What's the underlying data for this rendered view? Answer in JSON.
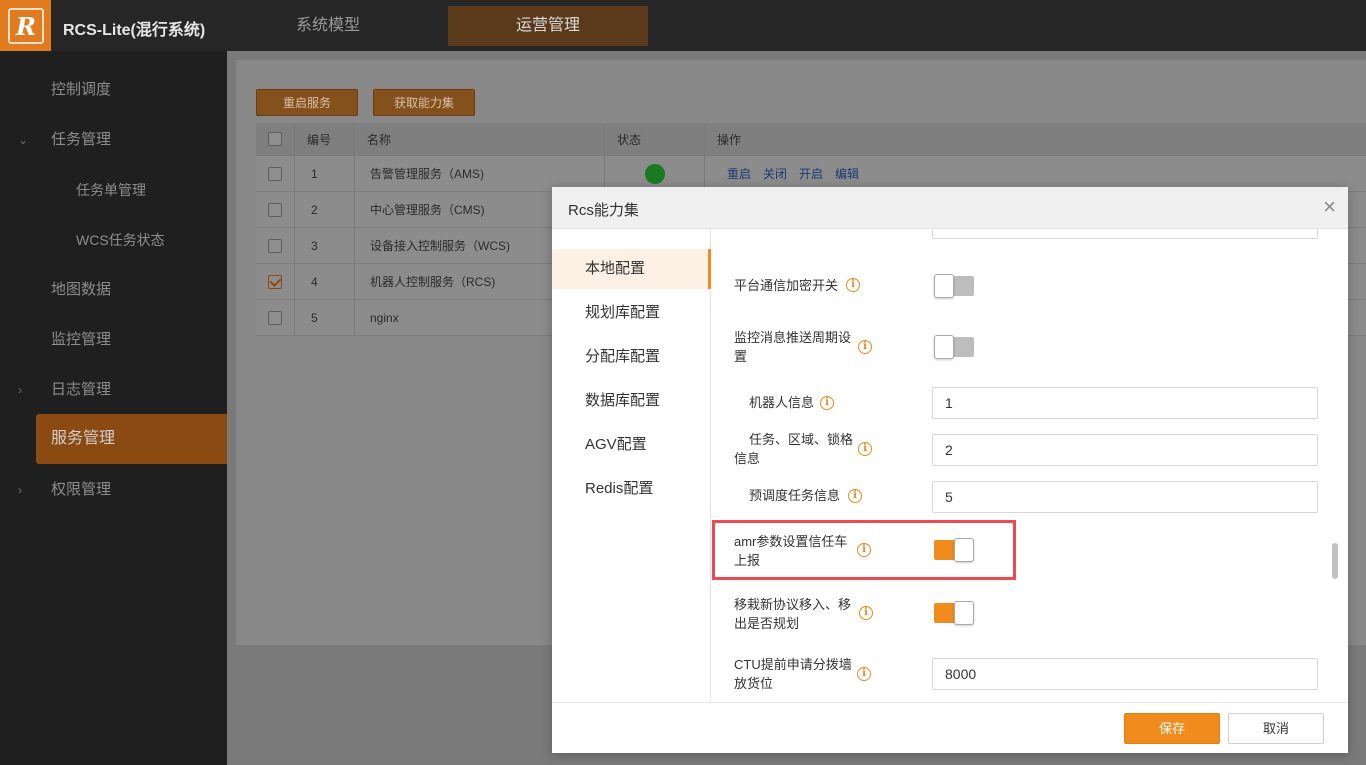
{
  "app": {
    "title": "RCS-Lite(混行系统)",
    "logo_letter": "R"
  },
  "top_tabs": [
    {
      "label": "系统模型"
    },
    {
      "label": "运营管理"
    }
  ],
  "sidebar": {
    "items": [
      {
        "label": "控制调度"
      },
      {
        "label": "任务管理",
        "arrow": "⌄"
      },
      {
        "label": "任务单管理"
      },
      {
        "label": "WCS任务状态"
      },
      {
        "label": "地图数据"
      },
      {
        "label": "监控管理"
      },
      {
        "label": "日志管理",
        "arrow": "›"
      },
      {
        "label": "服务管理"
      },
      {
        "label": "权限管理",
        "arrow": "›"
      }
    ]
  },
  "toolbar": {
    "restart_label": "重启服务",
    "capability_label": "获取能力集"
  },
  "table": {
    "headers": [
      "编号",
      "名称",
      "状态",
      "操作"
    ],
    "rows": [
      {
        "id": "1",
        "name": "告警管理服务（AMS)",
        "checked": false,
        "status": "green"
      },
      {
        "id": "2",
        "name": "中心管理服务（CMS)",
        "checked": false
      },
      {
        "id": "3",
        "name": "设备接入控制服务（WCS)",
        "checked": false
      },
      {
        "id": "4",
        "name": "机器人控制服务（RCS)",
        "checked": true
      },
      {
        "id": "5",
        "name": "nginx",
        "checked": false
      }
    ],
    "ops": [
      "重启",
      "关闭",
      "开启",
      "编辑"
    ]
  },
  "dialog": {
    "title": "Rcs能力集",
    "close": "×",
    "nav": [
      "本地配置",
      "规划库配置",
      "分配库配置",
      "数据库配置",
      "AGV配置",
      "Redis配置"
    ],
    "fields": {
      "platform_encrypt": "平台通信加密开关",
      "monitor_push_l1": "监控消息推送周期设",
      "monitor_push_l2": "置",
      "robot_info": "机器人信息",
      "robot_info_value": "1",
      "task_area_l1": "任务、区域、锁格",
      "task_area_l2": "信息",
      "task_area_value": "2",
      "predispatch": "预调度任务信息",
      "predispatch_value": "5",
      "amr_l1": "amr参数设置信任车",
      "amr_l2": "上报",
      "migrate_l1": "移栽新协议移入、移",
      "migrate_l2": "出是否规划",
      "ctu_l1": "CTU提前申请分拨墙",
      "ctu_l2": "放货位",
      "ctu_value": "8000",
      "info_glyph": "i"
    },
    "save_label": "保存",
    "cancel_label": "取消"
  },
  "colors": {
    "accent": "#f08c1e",
    "highlight": "#ef4a53",
    "status_ok": "#1ea82a"
  }
}
